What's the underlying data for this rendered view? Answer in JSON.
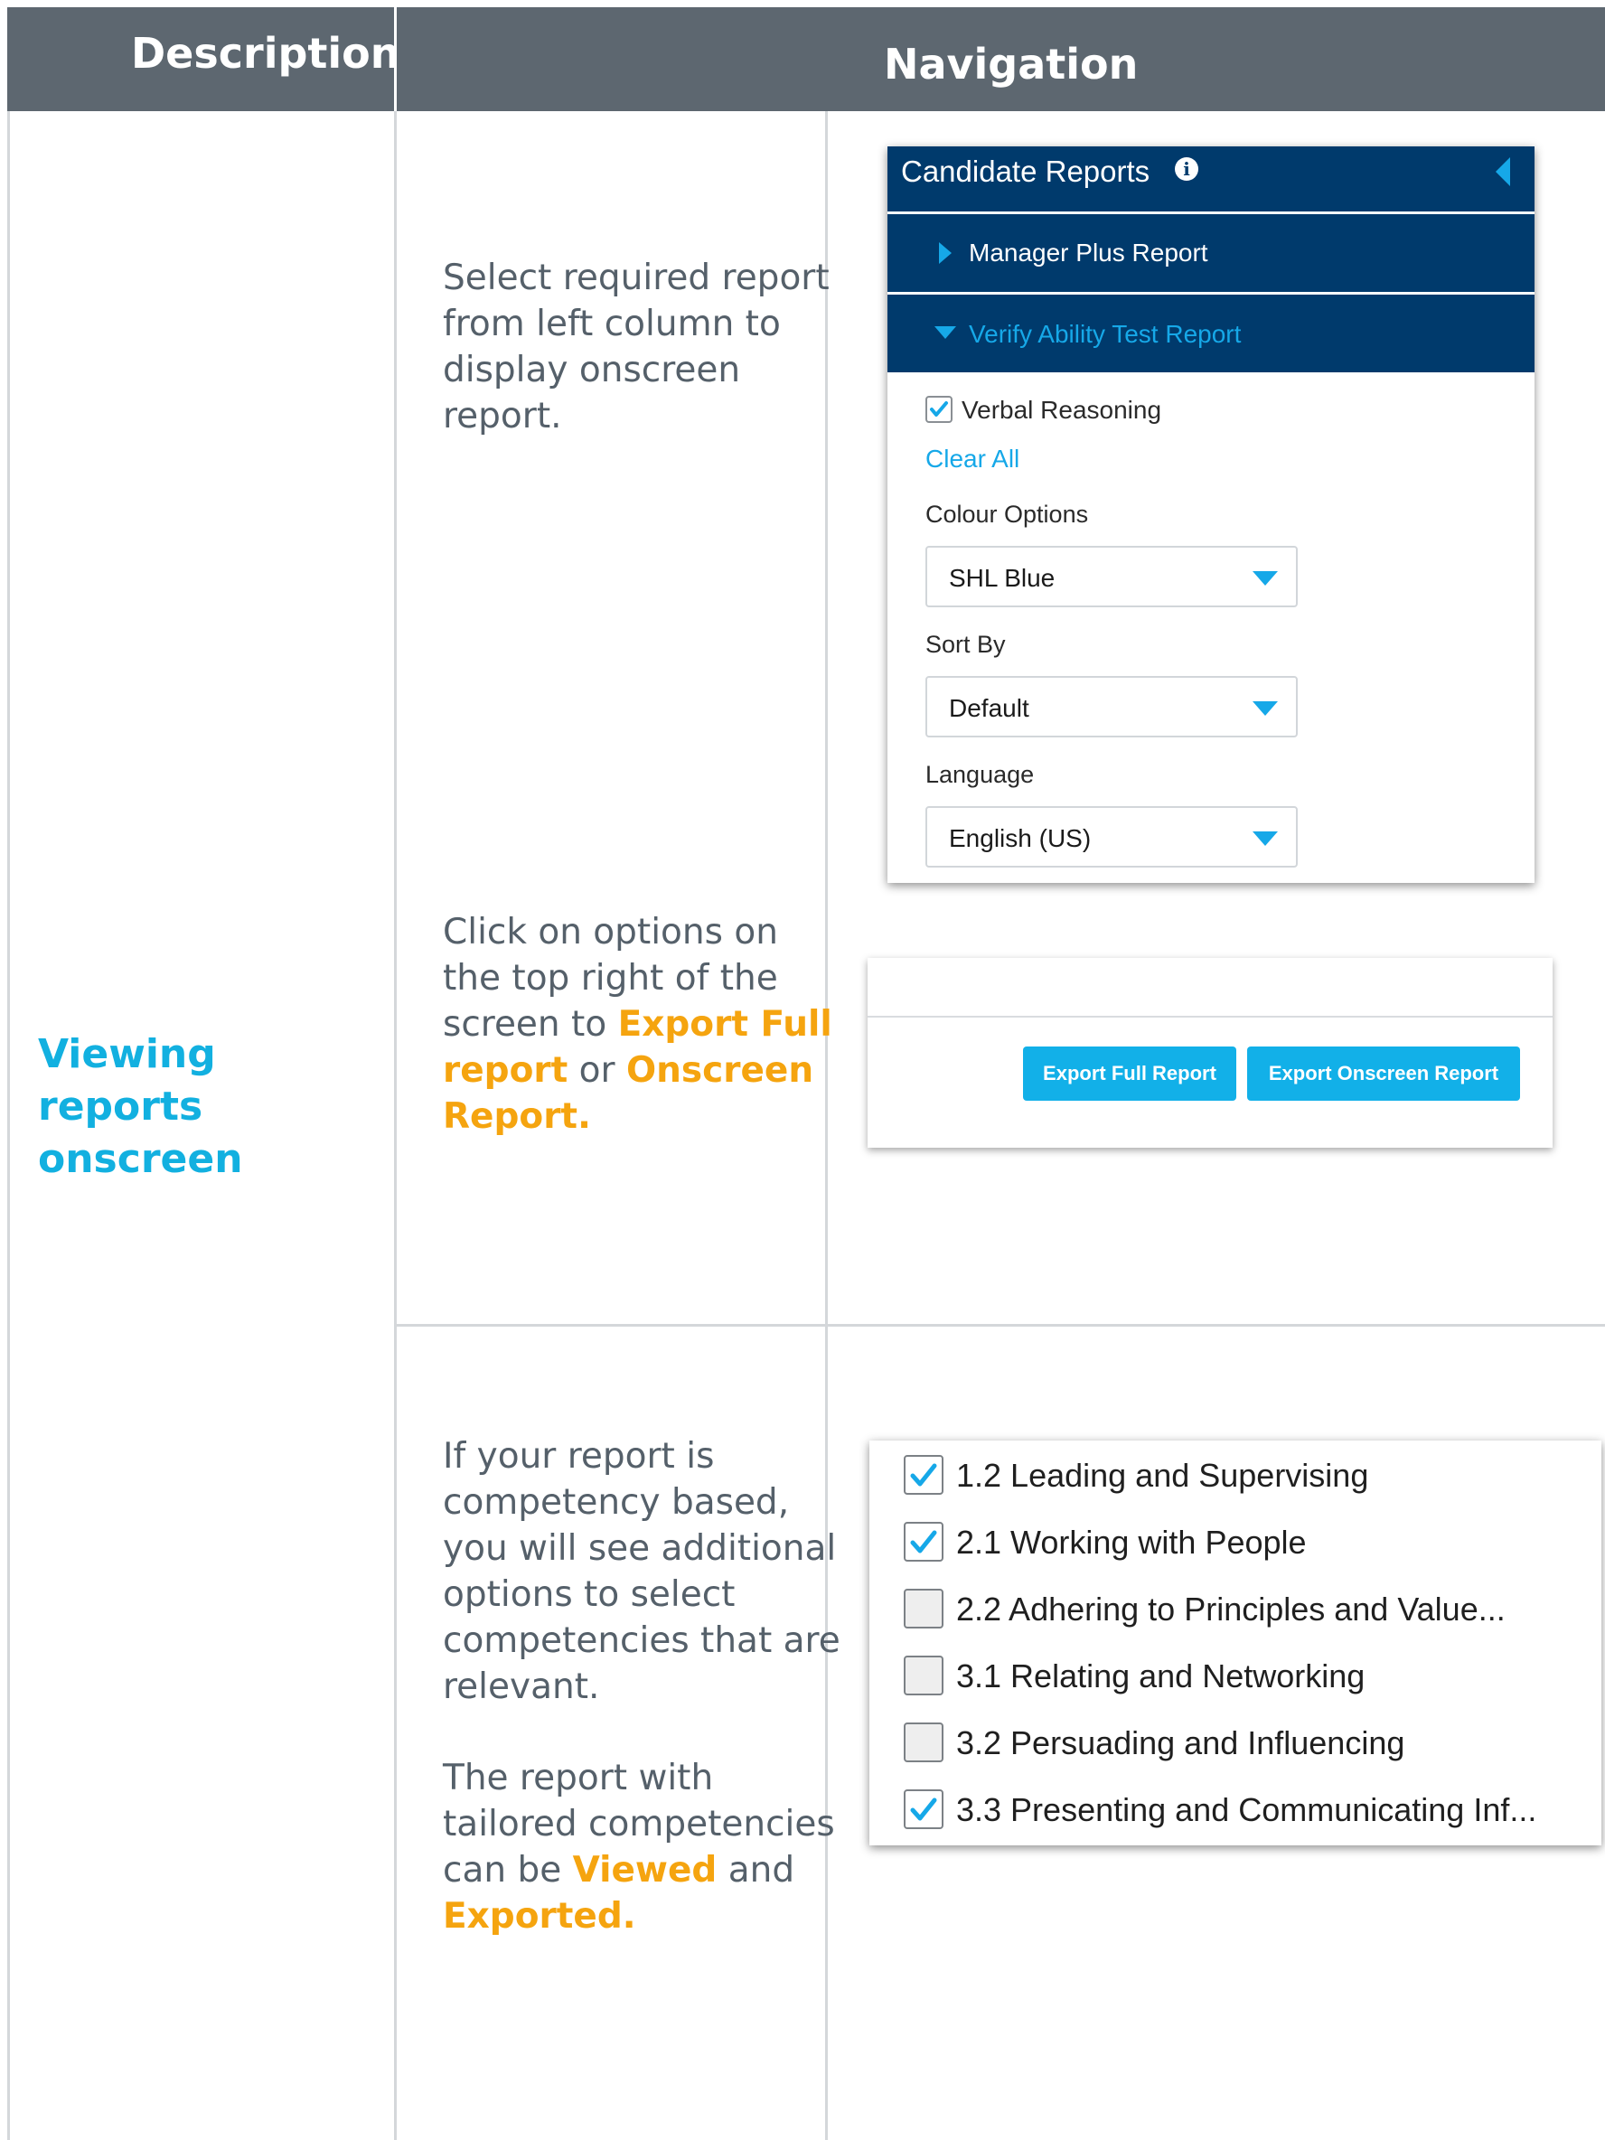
{
  "header": {
    "description": "Description",
    "navigation": "Navigation"
  },
  "section": {
    "title_lines": [
      "Viewing",
      "reports",
      "onscreen"
    ]
  },
  "row1": {
    "text1": "Select required report from left column to display onscreen report.",
    "text2_parts": [
      "Click on options on the top right of the screen to ",
      "Export Full report",
      " or ",
      "Onscreen Report."
    ]
  },
  "row2": {
    "text1": "If your report is competency based, you will see additional options to select competencies that are relevant.",
    "text2_parts": [
      "The report with tailored competencies can be ",
      "Viewed",
      " and ",
      "Exported."
    ]
  },
  "panel1": {
    "title": "Candidate Reports",
    "items": [
      "Manager Plus Report",
      "Verify Ability Test Report"
    ],
    "checkbox_label": "Verbal Reasoning",
    "checkbox_checked": true,
    "clear_all": "Clear All",
    "fields": [
      {
        "label": "Colour Options",
        "value": "SHL Blue"
      },
      {
        "label": "Sort By",
        "value": "Default"
      },
      {
        "label": "Language",
        "value": "English (US)"
      }
    ],
    "colors": {
      "header_bg": "#003a6c",
      "accent": "#16a8e8"
    },
    "icons": [
      "info-icon",
      "collapse-left-icon",
      "caret-right-icon",
      "caret-down-icon",
      "check-icon",
      "dropdown-arrow-icon"
    ]
  },
  "panel2": {
    "buttons": [
      "Export Full Report",
      "Export Onscreen Report"
    ],
    "button_color": "#12b0e8"
  },
  "panel3": {
    "competencies": [
      {
        "label": "1.2 Leading and Supervising",
        "checked": true
      },
      {
        "label": "2.1 Working with People",
        "checked": true
      },
      {
        "label": "2.2 Adhering to Principles and Value...",
        "checked": false
      },
      {
        "label": "3.1 Relating and Networking",
        "checked": false
      },
      {
        "label": "3.2 Persuading and Influencing",
        "checked": false
      },
      {
        "label": "3.3 Presenting and Communicating Inf...",
        "checked": true
      }
    ]
  }
}
